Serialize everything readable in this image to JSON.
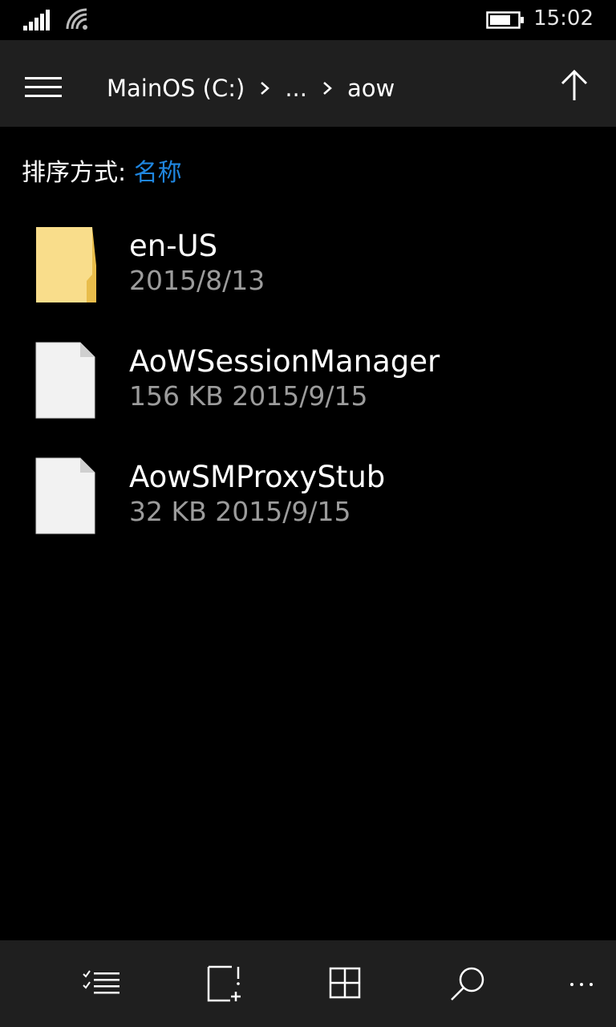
{
  "status_bar": {
    "time": "15:02",
    "icons": [
      "signal-icon",
      "wifi-icon",
      "battery-icon"
    ]
  },
  "header": {
    "menu_icon": "hamburger-icon",
    "breadcrumb": [
      "MainOS (C:)",
      "...",
      "aow"
    ],
    "up_icon": "arrow-up-icon"
  },
  "sort": {
    "label": "排序方式:",
    "value": "名称",
    "value_color": "#1f86e0"
  },
  "files": [
    {
      "name": "en-US",
      "meta": "2015/8/13",
      "icon": "folder-icon"
    },
    {
      "name": "AoWSessionManager",
      "meta": "156 KB  2015/9/15",
      "icon": "file-icon"
    },
    {
      "name": "AowSMProxyStub",
      "meta": "32 KB  2015/9/15",
      "icon": "file-icon"
    }
  ],
  "app_bar": {
    "buttons": [
      "select-icon",
      "new-item-icon",
      "view-icon",
      "search-icon",
      "more-icon"
    ],
    "more_label": "···"
  },
  "colors": {
    "background": "#000000",
    "bar": "#1f1f1f",
    "accent": "#1f86e0",
    "secondary_text": "#9c9c9c",
    "folder": "#f7d57a"
  }
}
